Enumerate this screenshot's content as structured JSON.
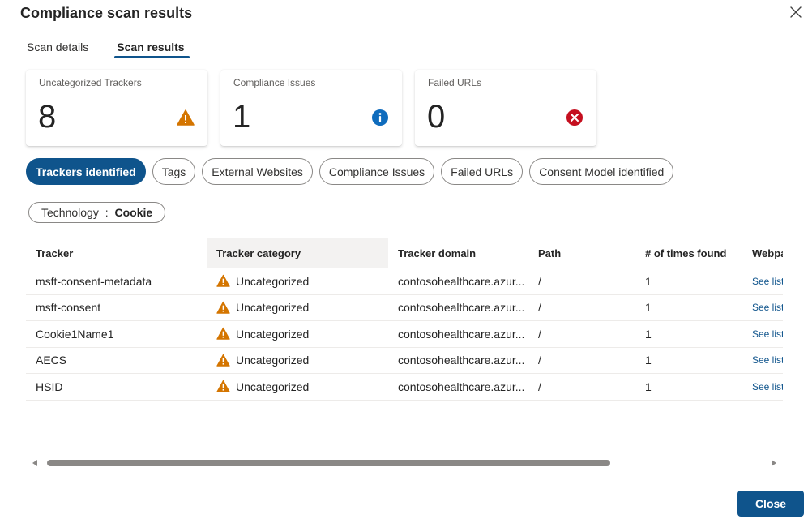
{
  "dialog": {
    "title": "Compliance scan results",
    "close_label": "Close"
  },
  "tabs": [
    {
      "label": "Scan details",
      "active": false
    },
    {
      "label": "Scan results",
      "active": true
    }
  ],
  "cards": [
    {
      "label": "Uncategorized Trackers",
      "value": "8",
      "icon": "warning-icon",
      "color": "#d47500"
    },
    {
      "label": "Compliance Issues",
      "value": "1",
      "icon": "info-icon",
      "color": "#0f6cbd"
    },
    {
      "label": "Failed URLs",
      "value": "0",
      "icon": "error-icon",
      "color": "#c50f1f"
    }
  ],
  "filters": [
    {
      "label": "Trackers identified",
      "active": true
    },
    {
      "label": "Tags",
      "active": false
    },
    {
      "label": "External Websites",
      "active": false
    },
    {
      "label": "Compliance Issues",
      "active": false
    },
    {
      "label": "Failed URLs",
      "active": false
    },
    {
      "label": "Consent Model identified",
      "active": false
    }
  ],
  "active_filter": {
    "key": "Technology",
    "separator": " : ",
    "value": "Cookie"
  },
  "table": {
    "columns": [
      "Tracker",
      "Tracker category",
      "Tracker domain",
      "Path",
      "# of times found",
      "Webpa"
    ],
    "rows": [
      {
        "tracker": "msft-consent-metadata",
        "category": "Uncategorized",
        "domain": "contosohealthcare.azur...",
        "path": "/",
        "times": "1",
        "webpages": "See list"
      },
      {
        "tracker": "msft-consent",
        "category": "Uncategorized",
        "domain": "contosohealthcare.azur...",
        "path": "/",
        "times": "1",
        "webpages": "See list"
      },
      {
        "tracker": "Cookie1Name1",
        "category": "Uncategorized",
        "domain": "contosohealthcare.azur...",
        "path": "/",
        "times": "1",
        "webpages": "See list"
      },
      {
        "tracker": "AECS",
        "category": "Uncategorized",
        "domain": "contosohealthcare.azur...",
        "path": "/",
        "times": "1",
        "webpages": "See list"
      },
      {
        "tracker": "HSID",
        "category": "Uncategorized",
        "domain": "contosohealthcare.azur...",
        "path": "/",
        "times": "1",
        "webpages": "See list"
      }
    ]
  },
  "colors": {
    "accent": "#0f548c",
    "warning": "#d47500",
    "info": "#0f6cbd",
    "error": "#c50f1f"
  }
}
